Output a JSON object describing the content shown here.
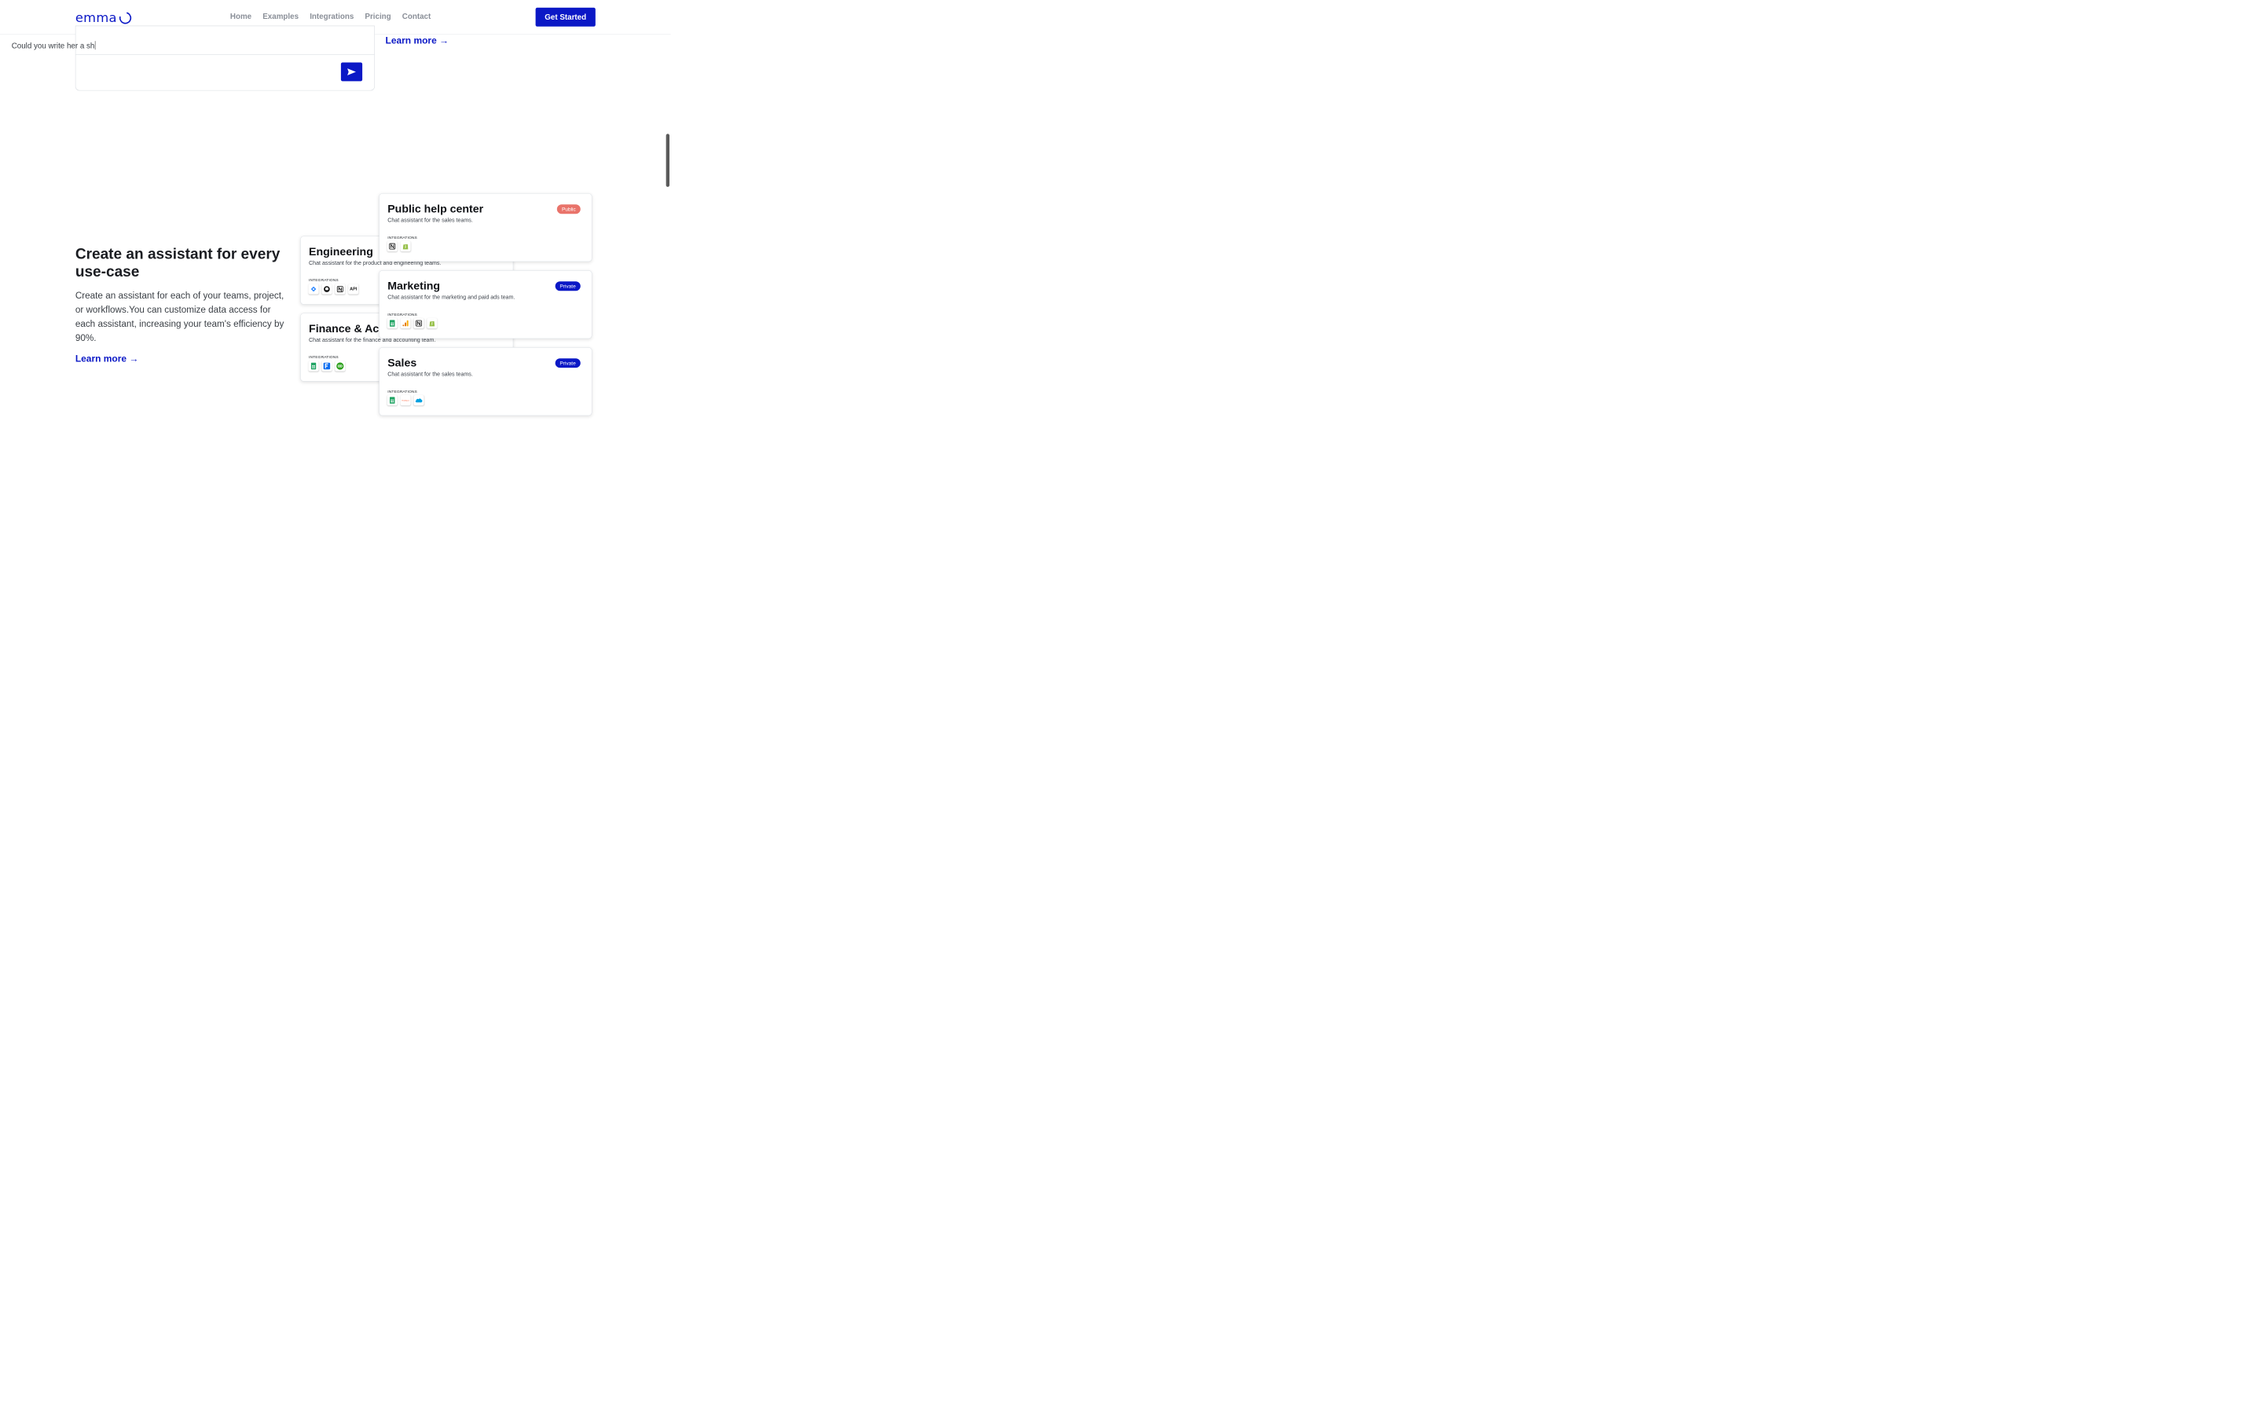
{
  "header": {
    "logo_text": "emma",
    "nav": [
      "Home",
      "Examples",
      "Integrations",
      "Pricing",
      "Contact"
    ],
    "cta_label": "Get Started"
  },
  "chat": {
    "input_text": "Could you write her a sh",
    "send_icon": "send-icon"
  },
  "learn_more_top": "Learn more →",
  "section": {
    "title": "Create an assistant for every use-case",
    "description": "Create an assistant for each of your teams, project, or workflows.You can customize data access for each assistant, increasing your team's efficiency by 90%.",
    "learn_more": "Learn more →"
  },
  "cards": {
    "engineering": {
      "title": "Engineering",
      "subtitle": "Chat assistant for the product and engineering teams.",
      "integrations_label": "INTEGRATIONS",
      "icons": [
        "jira-icon",
        "github-icon",
        "notion-icon",
        "api-icon"
      ],
      "api_label": "API"
    },
    "finance": {
      "title": "Finance & Accounting",
      "subtitle": "Chat assistant for the finance and accounting team.",
      "integrations_label": "INTEGRATIONS",
      "icons": [
        "google-sheets-icon",
        "freshbooks-icon",
        "quickbooks-icon"
      ]
    },
    "public_help": {
      "title": "Public help center",
      "subtitle": "Chat assistant for the sales teams.",
      "badge": "Public",
      "integrations_label": "INTEGRATIONS",
      "icons": [
        "notion-icon",
        "shopify-icon"
      ]
    },
    "marketing": {
      "title": "Marketing",
      "subtitle": "Chat assistant for the marketing and paid ads team.",
      "badge": "Private",
      "integrations_label": "INTEGRATIONS",
      "icons": [
        "google-sheets-icon",
        "google-analytics-icon",
        "notion-icon",
        "shopify-icon"
      ]
    },
    "sales": {
      "title": "Sales",
      "subtitle": "Chat assistant for the sales teams.",
      "badge": "Private",
      "integrations_label": "INTEGRATIONS",
      "icons": [
        "google-sheets-icon",
        "hubspot-icon",
        "salesforce-icon"
      ],
      "hubspot_label": "HubSpot"
    }
  },
  "colors": {
    "brand": "#0b18c6",
    "public_badge": "#e9736a",
    "nav_text": "#8a8f98"
  }
}
